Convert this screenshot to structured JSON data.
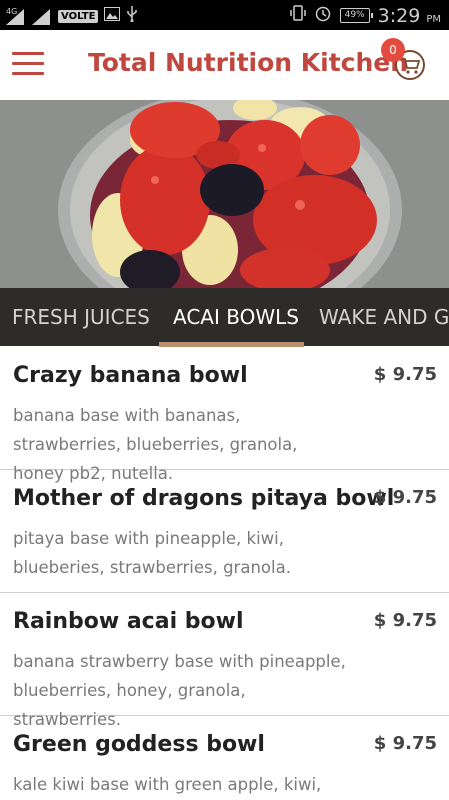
{
  "status_bar": {
    "network_type": "4G",
    "volte_label": "VOLTE",
    "battery_percent": "49%",
    "time": "3:29",
    "time_suffix": "PM"
  },
  "app_bar": {
    "title": "Total Nutrition Kitchen",
    "cart_count": "0",
    "accent_color": "#c0473f"
  },
  "hero": {
    "icon": "acai-bowl-photo"
  },
  "tabs": [
    {
      "label": "FRESH JUICES",
      "active": false
    },
    {
      "label": "ACAI BOWLS",
      "active": true
    },
    {
      "label": "WAKE AND GO",
      "active": false
    }
  ],
  "menu_items": [
    {
      "name": "Crazy banana bowl",
      "price": "$ 9.75",
      "description": "banana base with bananas, strawberries, blueberries, granola, honey pb2, nutella."
    },
    {
      "name": "Mother of dragons pitaya bowl",
      "price": "$ 9.75",
      "description": "pitaya base with pineapple, kiwi, blueberies, strawberries, granola."
    },
    {
      "name": "Rainbow acai bowl",
      "price": "$ 9.75",
      "description": "banana strawberry base with pineapple, blueberries, honey, granola, strawberries."
    },
    {
      "name": "Green goddess bowl",
      "price": "$ 9.75",
      "description": "kale kiwi base with green apple, kiwi,"
    }
  ]
}
